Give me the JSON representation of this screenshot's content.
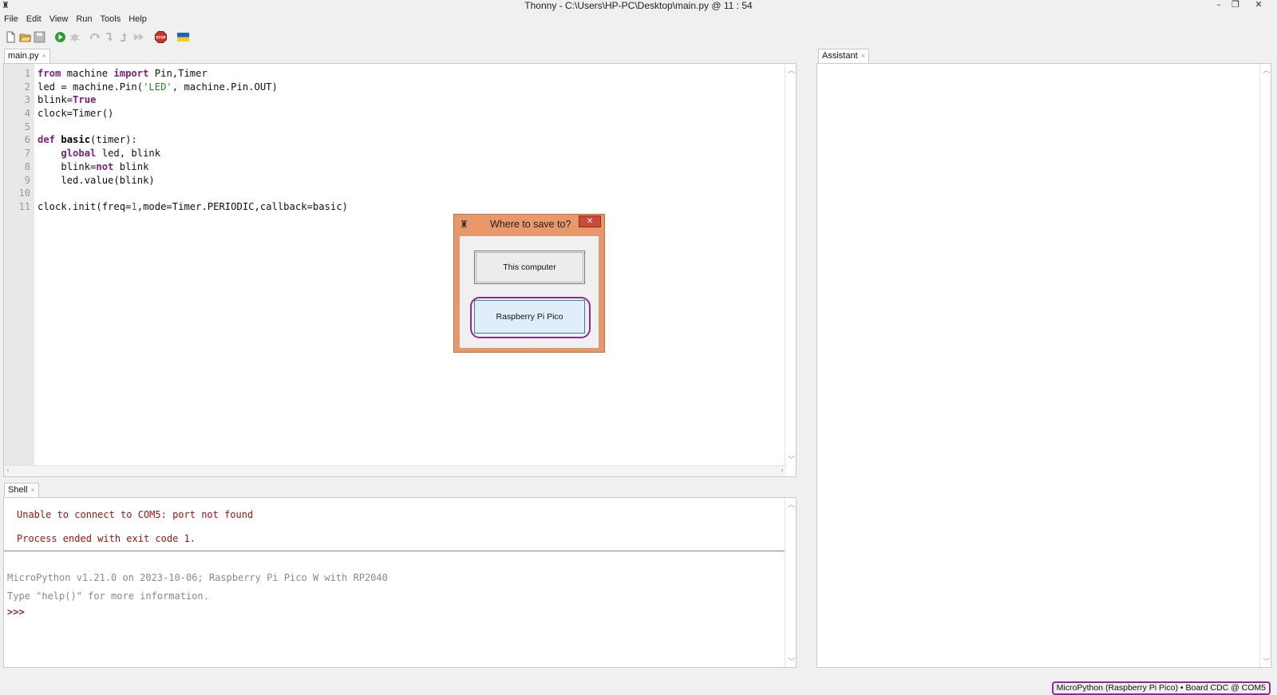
{
  "window": {
    "title": "Thonny  -  C:\\Users\\HP-PC\\Desktop\\main.py  @  11 : 54",
    "minimize": "–",
    "restore": "❐",
    "close": "✕"
  },
  "menu": [
    "File",
    "Edit",
    "View",
    "Run",
    "Tools",
    "Help"
  ],
  "toolbar": {
    "icons": [
      "new-file-icon",
      "open-file-icon",
      "save-icon",
      "run-icon",
      "debug-icon",
      "step-over-icon",
      "step-into-icon",
      "step-out-icon",
      "resume-icon",
      "stop-icon",
      "ukraine-flag-icon"
    ],
    "stop_label": "STOP"
  },
  "editor": {
    "tab_label": "main.py",
    "tab_close": "×",
    "line_numbers": [
      "1",
      "2",
      "3",
      "4",
      "5",
      "6",
      "7",
      "8",
      "9",
      "10",
      "11"
    ]
  },
  "shell": {
    "tab_label": "Shell",
    "tab_close": "×",
    "error_line1": "Unable to connect to COM5: port not found",
    "error_line2": "Process ended with exit code 1.",
    "info_line1": "MicroPython v1.21.0 on 2023-10-06; Raspberry Pi Pico W with RP2040",
    "info_line2": "Type \"help()\" for more information.",
    "prompt": ">>>"
  },
  "assistant": {
    "tab_label": "Assistant",
    "tab_close": "×"
  },
  "status_bar": {
    "text": "MicroPython (Raspberry Pi Pico)  •  Board CDC @ COM5"
  },
  "dialog": {
    "title": "Where to save to?",
    "close": "✕",
    "button_computer": "This computer",
    "button_pico": "Raspberry Pi Pico"
  }
}
